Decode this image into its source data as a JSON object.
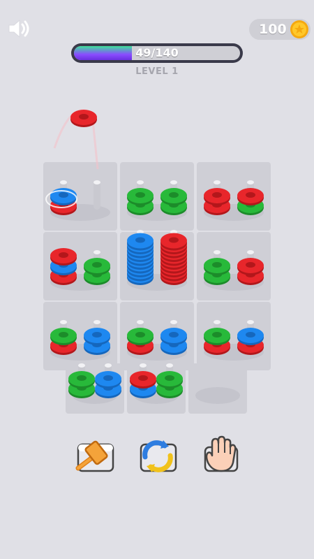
{
  "hud": {
    "sound_icon": "speaker-icon",
    "coins": "100",
    "coin_icon": "gold-star-coin-icon",
    "progress_text": "49/140",
    "progress_fraction": 0.35,
    "level_label": "LEVEL 1"
  },
  "colors": {
    "red": "#e8262b",
    "green": "#28b93a",
    "blue": "#1e88f0",
    "peg": "#c9c9d0",
    "board_tile": "#cfcfd6",
    "background": "#e0e0e6"
  },
  "held_ring": "red",
  "board": {
    "rows": [
      [
        {
          "pegs": [
            [
              "red",
              "blue"
            ],
            []
          ],
          "highlighted": true
        },
        {
          "pegs": [
            [
              "green",
              "green"
            ],
            [
              "green",
              "green"
            ]
          ]
        },
        {
          "pegs": [
            [
              "red",
              "red"
            ],
            [
              "green",
              "red"
            ]
          ]
        }
      ],
      [
        {
          "pegs": [
            [
              "red",
              "blue",
              "red"
            ],
            [
              "green",
              "green"
            ]
          ]
        },
        {
          "pegs": [
            [
              "blue",
              "blue",
              "blue",
              "blue",
              "blue",
              "blue",
              "blue",
              "blue",
              "blue",
              "blue"
            ],
            [
              "red",
              "red",
              "red",
              "red",
              "red",
              "red",
              "red",
              "red",
              "red",
              "red"
            ]
          ]
        },
        {
          "pegs": [
            [
              "green",
              "green"
            ],
            [
              "red",
              "red"
            ]
          ]
        }
      ],
      [
        {
          "pegs": [
            [
              "red",
              "green"
            ],
            [
              "blue",
              "blue"
            ]
          ]
        },
        {
          "pegs": [
            [
              "red",
              "green"
            ],
            [
              "blue",
              "blue"
            ]
          ]
        },
        {
          "pegs": [
            [
              "red",
              "green"
            ],
            [
              "red",
              "blue"
            ]
          ]
        }
      ]
    ],
    "extra": [
      {
        "pegs": [
          [
            "green",
            "green"
          ],
          [
            "blue",
            "blue"
          ]
        ]
      },
      {
        "pegs": [
          [
            "blue",
            "red"
          ],
          [
            "green",
            "green"
          ]
        ]
      },
      {
        "pegs": [],
        "empty": true
      }
    ]
  },
  "tools": [
    {
      "name": "hammer-tool-icon"
    },
    {
      "name": "shuffle-tool-icon"
    },
    {
      "name": "hand-tool-icon"
    }
  ]
}
